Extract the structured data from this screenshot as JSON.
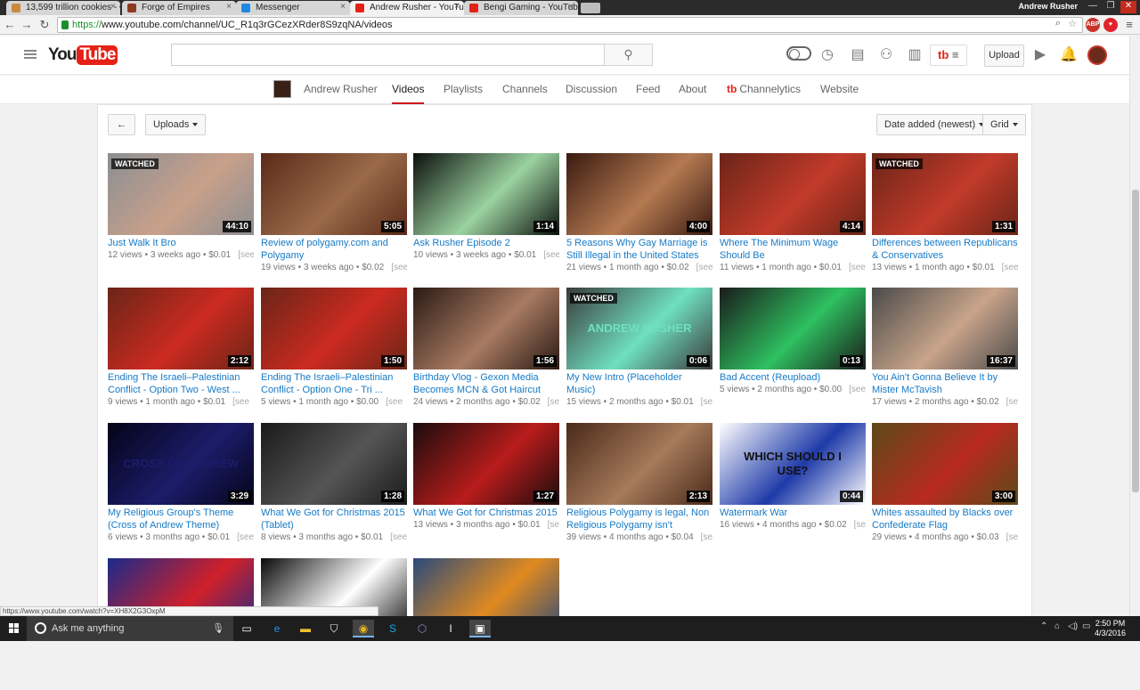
{
  "browser": {
    "tabs": [
      {
        "label": "13,599 trillion cookies - C",
        "color": "#c98a3b"
      },
      {
        "label": "Forge of Empires",
        "color": "#8c3b1e"
      },
      {
        "label": "Messenger",
        "color": "#1e88e5"
      },
      {
        "label": "Andrew Rusher - YouTube",
        "color": "#e62117"
      },
      {
        "label": "Bengi Gaming - YouTube",
        "color": "#e62117"
      }
    ],
    "profile": "Andrew Rusher",
    "url_scheme": "https://",
    "url_rest": "www.youtube.com/channel/UC_R1q3rGCezXRder8S9zqNA/videos",
    "status_url": "https://www.youtube.com/watch?v=XH8X2G3OxpM"
  },
  "header": {
    "logo_you": "You",
    "logo_tube": "Tube",
    "search_placeholder": "",
    "tb_label": "tb",
    "upload_label": "Upload"
  },
  "channel_nav": {
    "tabs": [
      "Andrew Rusher",
      "Videos",
      "Playlists",
      "Channels",
      "Discussion",
      "Feed",
      "About",
      "Channelytics",
      "Website"
    ],
    "channelytics_prefix": "tb"
  },
  "controls": {
    "back": "←",
    "uploads": "Uploads",
    "sort": "Date added (newest)",
    "view": "Grid"
  },
  "videos": [
    {
      "title": "Just Walk It Bro",
      "duration": "44:10",
      "watched": true,
      "views": "12 views",
      "age": "3 weeks ago",
      "earn": "$0.01",
      "bg": "#8a8f93",
      "accent": "#c9a08a"
    },
    {
      "title": "Review of polygamy.com and Polygamy",
      "duration": "5:05",
      "watched": false,
      "views": "19 views",
      "age": "3 weeks ago",
      "earn": "$0.02",
      "bg": "#5a2a18",
      "accent": "#9a6a4a"
    },
    {
      "title": "Ask Rusher Episode 2",
      "duration": "1:14",
      "watched": false,
      "views": "10 views",
      "age": "3 weeks ago",
      "earn": "$0.01",
      "bg": "#0b0f0c",
      "accent": "#9bd2a0"
    },
    {
      "title": "5 Reasons Why Gay Marriage is Still Illegal in the United States",
      "duration": "4:00",
      "watched": false,
      "views": "21 views",
      "age": "1 month ago",
      "earn": "$0.02",
      "bg": "#3a1a10",
      "accent": "#b47a52"
    },
    {
      "title": "Where The Minimum Wage Should Be",
      "duration": "4:14",
      "watched": false,
      "views": "11 views",
      "age": "1 month ago",
      "earn": "$0.01",
      "bg": "#6a2518",
      "accent": "#c23a2a"
    },
    {
      "title": "Differences between Republicans & Conservatives",
      "duration": "1:31",
      "watched": true,
      "views": "13 views",
      "age": "1 month ago",
      "earn": "$0.01",
      "bg": "#6a2518",
      "accent": "#c23a2a"
    },
    {
      "title": "Ending The Israeli–Palestinian Conflict - Option Two - West ...",
      "duration": "2:12",
      "watched": false,
      "views": "9 views",
      "age": "1 month ago",
      "earn": "$0.01",
      "bg": "#6a2518",
      "accent": "#cc2a20"
    },
    {
      "title": "Ending The Israeli–Palestinian Conflict - Option One - Tri ...",
      "duration": "1:50",
      "watched": false,
      "views": "5 views",
      "age": "1 month ago",
      "earn": "$0.00",
      "bg": "#6a2518",
      "accent": "#cc2a20"
    },
    {
      "title": "Birthday Vlog - Gexon Media Becomes MCN & Got Haircut",
      "duration": "1:56",
      "watched": false,
      "views": "24 views",
      "age": "2 months ago",
      "earn": "$0.02",
      "bg": "#2a1a14",
      "accent": "#a87a62"
    },
    {
      "title": "My New Intro (Placeholder Music)",
      "duration": "0:06",
      "watched": true,
      "views": "15 views",
      "age": "2 months ago",
      "earn": "$0.01",
      "bg": "#3a3a3a",
      "accent": "#6fe0c0",
      "overlay_text": "ANDREW RUSHER"
    },
    {
      "title": "Bad Accent (Reupload)",
      "duration": "0:13",
      "watched": false,
      "views": "5 views",
      "age": "2 months ago",
      "earn": "$0.00",
      "bg": "#1a1a1a",
      "accent": "#2ec060"
    },
    {
      "title": "You Ain't Gonna Believe It by Mister McTavish",
      "duration": "16:37",
      "watched": false,
      "views": "17 views",
      "age": "2 months ago",
      "earn": "$0.02",
      "bg": "#4a4a4a",
      "accent": "#c8a48a"
    },
    {
      "title": "My Religious Group's Theme (Cross of Andrew Theme)",
      "duration": "3:29",
      "watched": false,
      "views": "6 views",
      "age": "3 months ago",
      "earn": "$0.01",
      "bg": "#040418",
      "accent": "#1c1c6a",
      "overlay_text": "CROSS OF ANDREW"
    },
    {
      "title": "What We Got for Christmas 2015 (Tablet)",
      "duration": "1:28",
      "watched": false,
      "views": "8 views",
      "age": "3 months ago",
      "earn": "$0.01",
      "bg": "#1a1a1a",
      "accent": "#555555"
    },
    {
      "title": "What We Got for Christmas 2015",
      "duration": "1:27",
      "watched": false,
      "views": "13 views",
      "age": "3 months ago",
      "earn": "$0.01",
      "bg": "#1a0c0c",
      "accent": "#b81c1c"
    },
    {
      "title": "Religious Polygamy is legal, Non Religious Polygamy isn't",
      "duration": "2:13",
      "watched": false,
      "views": "39 views",
      "age": "4 months ago",
      "earn": "$0.04",
      "bg": "#4a2a1a",
      "accent": "#a67a5a"
    },
    {
      "title": "Watermark War",
      "duration": "0:44",
      "watched": false,
      "views": "16 views",
      "age": "4 months ago",
      "earn": "$0.02",
      "bg": "#ffffff",
      "accent": "#1e3aa8",
      "overlay_text": "WHICH SHOULD I USE?"
    },
    {
      "title": "Whites assaulted by Blacks over Confederate Flag",
      "duration": "3:00",
      "watched": false,
      "views": "29 views",
      "age": "4 months ago",
      "earn": "$0.03",
      "bg": "#5a4a1a",
      "accent": "#b82a1e"
    },
    {
      "title": "",
      "duration": "",
      "watched": false,
      "views": "",
      "age": "",
      "earn": "",
      "bg": "#1a2a8a",
      "accent": "#d0202a"
    },
    {
      "title": "",
      "duration": "",
      "watched": false,
      "views": "",
      "age": "",
      "earn": "",
      "bg": "#0a0a0a",
      "accent": "#ffffff"
    },
    {
      "title": "",
      "duration": "",
      "watched": false,
      "views": "",
      "age": "",
      "earn": "",
      "bg": "#2a4a7a",
      "accent": "#e08a20"
    }
  ],
  "watched_label": "WATCHED",
  "see_label": "[see",
  "taskbar": {
    "search_placeholder": "Ask me anything",
    "time": "2:50 PM",
    "date": "4/3/2016"
  }
}
